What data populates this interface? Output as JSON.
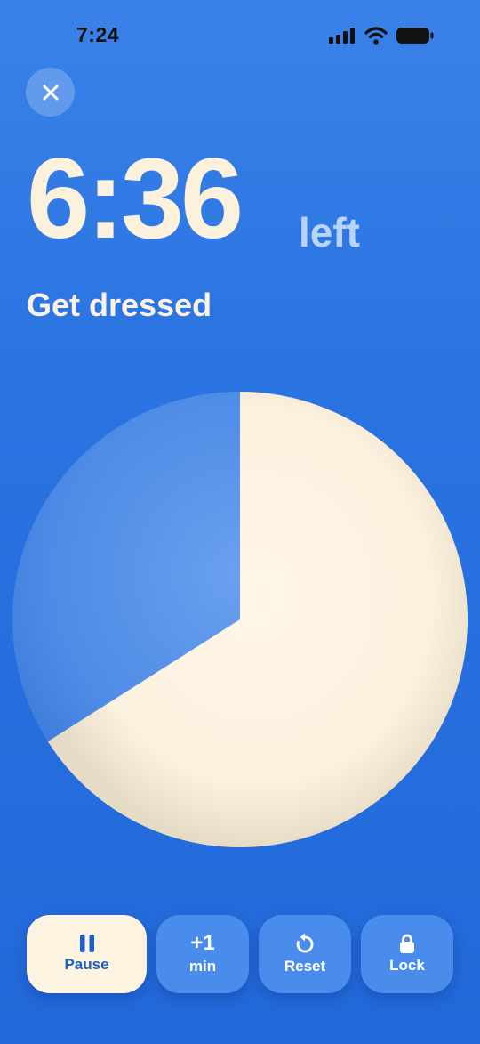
{
  "status_bar": {
    "time": "7:24"
  },
  "timer": {
    "remaining": "6:36",
    "suffix": "left",
    "task": "Get dressed",
    "remaining_fraction": 0.66
  },
  "controls": {
    "pause_label": "Pause",
    "add_top": "+1",
    "add_bottom": "min",
    "reset_label": "Reset",
    "lock_label": "Lock"
  },
  "colors": {
    "background": "#2a74e2",
    "dial_fill": "#fbf1df",
    "dial_empty": "#4f8ee8",
    "accent": "#1f5fc9"
  }
}
